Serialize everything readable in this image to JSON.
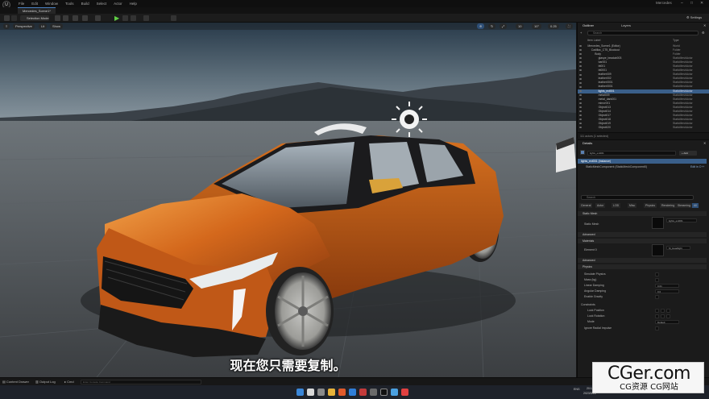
{
  "window": {
    "app_title": "Mercedes",
    "menu": [
      "File",
      "Edit",
      "Window",
      "Tools",
      "Build",
      "Select",
      "Actor",
      "Help"
    ],
    "tab_label": "Mercedes_Scene1*"
  },
  "toolbar": {
    "mode_label": "Selection Mode",
    "settings_label": "Settings"
  },
  "viewport": {
    "perspective_label": "Perspective",
    "lit_label": "Lit",
    "show_label": "Show",
    "grid_values": [
      "10",
      "10°",
      "0.25"
    ],
    "subtitle": "现在您只需要复制。"
  },
  "outliner": {
    "tab_outliner": "Outliner",
    "tab_layers": "Layers",
    "search_placeholder": "Search",
    "col_label": "Item Label",
    "col_type": "Type",
    "rows": [
      {
        "label": "Mercedes_Scene1 (Editor)",
        "type": "World",
        "sel": false,
        "indent": 2
      },
      {
        "label": "Cadillac_CT5_Blockout",
        "type": "Folder",
        "sel": false,
        "indent": 4
      },
      {
        "label": "Body",
        "type": "Folder",
        "sel": false,
        "indent": 6
      },
      {
        "label": "glaspe_beadab003",
        "type": "StaticMeshActor",
        "sel": false,
        "indent": 8
      },
      {
        "label": "bar001",
        "type": "StaticMeshActor",
        "sel": false,
        "indent": 8
      },
      {
        "label": "bt001",
        "type": "StaticMeshActor",
        "sel": false,
        "indent": 8
      },
      {
        "label": "bt0001",
        "type": "StaticMeshActor",
        "sel": false,
        "indent": 8
      },
      {
        "label": "leather009",
        "type": "StaticMeshActor",
        "sel": false,
        "indent": 8
      },
      {
        "label": "leather002",
        "type": "StaticMeshActor",
        "sel": false,
        "indent": 8
      },
      {
        "label": "leather0001",
        "type": "StaticMeshActor",
        "sel": false,
        "indent": 8
      },
      {
        "label": "leather0001",
        "type": "StaticMeshActor",
        "sel": false,
        "indent": 8
      },
      {
        "label": "lights_ext001",
        "type": "StaticMeshActor",
        "sel": true,
        "indent": 8
      },
      {
        "label": "metal009",
        "type": "StaticMeshActor",
        "sel": false,
        "indent": 8
      },
      {
        "label": "metal_dark001",
        "type": "StaticMeshActor",
        "sel": false,
        "indent": 8
      },
      {
        "label": "mirror001",
        "type": "StaticMeshActor",
        "sel": false,
        "indent": 8
      },
      {
        "label": "Object013",
        "type": "StaticMeshActor",
        "sel": false,
        "indent": 8
      },
      {
        "label": "Object014",
        "type": "StaticMeshActor",
        "sel": false,
        "indent": 8
      },
      {
        "label": "Object017",
        "type": "StaticMeshActor",
        "sel": false,
        "indent": 8
      },
      {
        "label": "Object018",
        "type": "StaticMeshActor",
        "sel": false,
        "indent": 8
      },
      {
        "label": "Object019",
        "type": "StaticMeshActor",
        "sel": false,
        "indent": 8
      },
      {
        "label": "Object020",
        "type": "StaticMeshActor",
        "sel": false,
        "indent": 8
      }
    ],
    "footer": "111 actors (1 selected)"
  },
  "details": {
    "tab": "Details",
    "actor_name": "lights_ext001",
    "add_label": "+ Add",
    "instance_label": "lights_ext001 (Instance)",
    "component_path": "StaticMeshComponent (StaticMeshComponent0)",
    "edit_in_cpp": "Edit in C++",
    "search_placeholder": "Search",
    "filters": [
      "General",
      "Actor",
      "LOD",
      "Misc",
      "Physics",
      "Rendering",
      "Streaming",
      "All"
    ],
    "sections": {
      "static_mesh": "Static Mesh",
      "advanced": "Advanced",
      "materials": "Materials",
      "physics": "Physics",
      "collision": "Collision"
    },
    "static_mesh_label": "Static Mesh",
    "static_mesh_value": "lights_ext001",
    "element_label": "Element 0",
    "element_value": "M_Headlight",
    "physics_rows": [
      "Simulate Physics",
      "Mass (kg)",
      "Linear Damping",
      "Angular Damping",
      "Enable Gravity"
    ],
    "physics_values": [
      "",
      "",
      "0.01",
      "0.0",
      ""
    ],
    "constraints_label": "Constraints",
    "constraint_rows": [
      "Lock Position",
      "Lock Rotation",
      "Mode"
    ],
    "mode_value": "Default",
    "ignore_label": "Ignore Radial Impulse"
  },
  "statusbar": {
    "content_drawer": "Content Drawer",
    "output_log": "Output Log",
    "cmd": "Cmd",
    "cmd_placeholder": "Enter Console Command"
  },
  "taskbar": {
    "lang": "ENG",
    "time": "20:14",
    "date": "2023/5/16"
  },
  "watermark": {
    "title": "CGer.com",
    "subtitle": "CG资源 CG网站"
  },
  "colors": {
    "accent": "#3a5f8a",
    "play": "#5fcf45",
    "car_orange": "#d4681c"
  }
}
